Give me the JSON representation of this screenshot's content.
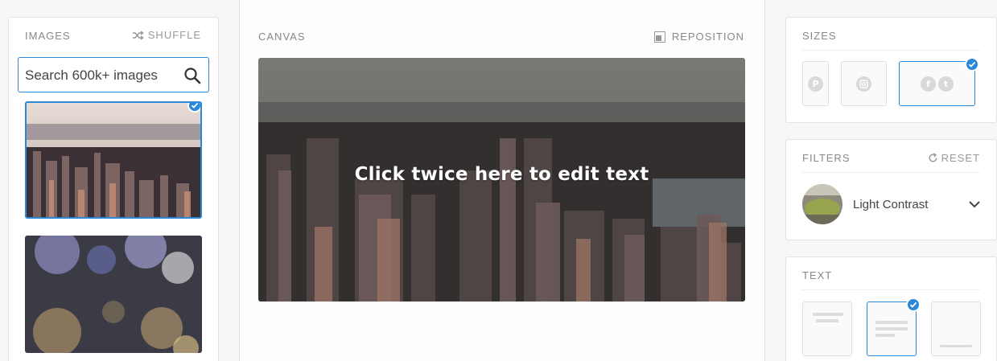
{
  "images_panel": {
    "title": "IMAGES",
    "shuffle_label": "SHUFFLE",
    "search_placeholder": "Search 600k+ images",
    "thumbnails": [
      {
        "subject": "city-aerial",
        "selected": true
      },
      {
        "subject": "rain-bokeh",
        "selected": false
      }
    ]
  },
  "canvas": {
    "title": "CANVAS",
    "reposition_label": "REPOSITION",
    "overlay_text": "Click twice here to edit text"
  },
  "sizes_panel": {
    "title": "SIZES",
    "options": [
      {
        "icon": "pinterest-icon",
        "selected": false
      },
      {
        "icon": "instagram-icon",
        "selected": false
      },
      {
        "icon": "facebook-twitter-icon",
        "selected": true
      }
    ]
  },
  "filters_panel": {
    "title": "FILTERS",
    "reset_label": "RESET",
    "selected_filter": "Light Contrast"
  },
  "text_panel": {
    "title": "TEXT",
    "options": [
      {
        "layout": "top",
        "selected": false
      },
      {
        "layout": "center",
        "selected": true
      },
      {
        "layout": "bottom",
        "selected": false
      }
    ]
  },
  "colors": {
    "accent": "#2b87d8",
    "border": "#e2e2e2",
    "label": "#888888"
  }
}
